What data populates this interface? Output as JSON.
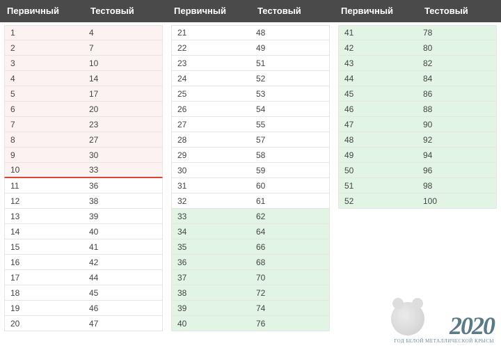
{
  "headers": {
    "primary": "Первичный",
    "test": "Тестовый"
  },
  "columns": [
    {
      "rows": [
        {
          "p": "1",
          "t": "4",
          "tone": "red"
        },
        {
          "p": "2",
          "t": "7",
          "tone": "red"
        },
        {
          "p": "3",
          "t": "10",
          "tone": "red"
        },
        {
          "p": "4",
          "t": "14",
          "tone": "red"
        },
        {
          "p": "5",
          "t": "17",
          "tone": "red"
        },
        {
          "p": "6",
          "t": "20",
          "tone": "red"
        },
        {
          "p": "7",
          "t": "23",
          "tone": "red"
        },
        {
          "p": "8",
          "t": "27",
          "tone": "red"
        },
        {
          "p": "9",
          "t": "30",
          "tone": "red"
        },
        {
          "p": "10",
          "t": "33",
          "tone": "red",
          "redline": true
        },
        {
          "p": "11",
          "t": "36",
          "tone": "white"
        },
        {
          "p": "12",
          "t": "38",
          "tone": "white"
        },
        {
          "p": "13",
          "t": "39",
          "tone": "white"
        },
        {
          "p": "14",
          "t": "40",
          "tone": "white"
        },
        {
          "p": "15",
          "t": "41",
          "tone": "white"
        },
        {
          "p": "16",
          "t": "42",
          "tone": "white"
        },
        {
          "p": "17",
          "t": "44",
          "tone": "white"
        },
        {
          "p": "18",
          "t": "45",
          "tone": "white"
        },
        {
          "p": "19",
          "t": "46",
          "tone": "white"
        },
        {
          "p": "20",
          "t": "47",
          "tone": "white"
        }
      ]
    },
    {
      "rows": [
        {
          "p": "21",
          "t": "48",
          "tone": "white"
        },
        {
          "p": "22",
          "t": "49",
          "tone": "white"
        },
        {
          "p": "23",
          "t": "51",
          "tone": "white"
        },
        {
          "p": "24",
          "t": "52",
          "tone": "white"
        },
        {
          "p": "25",
          "t": "53",
          "tone": "white"
        },
        {
          "p": "26",
          "t": "54",
          "tone": "white"
        },
        {
          "p": "27",
          "t": "55",
          "tone": "white"
        },
        {
          "p": "28",
          "t": "57",
          "tone": "white"
        },
        {
          "p": "29",
          "t": "58",
          "tone": "white"
        },
        {
          "p": "30",
          "t": "59",
          "tone": "white"
        },
        {
          "p": "31",
          "t": "60",
          "tone": "white"
        },
        {
          "p": "32",
          "t": "61",
          "tone": "white"
        },
        {
          "p": "33",
          "t": "62",
          "tone": "green"
        },
        {
          "p": "34",
          "t": "64",
          "tone": "green"
        },
        {
          "p": "35",
          "t": "66",
          "tone": "green"
        },
        {
          "p": "36",
          "t": "68",
          "tone": "green"
        },
        {
          "p": "37",
          "t": "70",
          "tone": "green"
        },
        {
          "p": "38",
          "t": "72",
          "tone": "green"
        },
        {
          "p": "39",
          "t": "74",
          "tone": "green"
        },
        {
          "p": "40",
          "t": "76",
          "tone": "green"
        }
      ]
    },
    {
      "rows": [
        {
          "p": "41",
          "t": "78",
          "tone": "green"
        },
        {
          "p": "42",
          "t": "80",
          "tone": "green"
        },
        {
          "p": "43",
          "t": "82",
          "tone": "green"
        },
        {
          "p": "44",
          "t": "84",
          "tone": "green"
        },
        {
          "p": "45",
          "t": "86",
          "tone": "green"
        },
        {
          "p": "46",
          "t": "88",
          "tone": "green"
        },
        {
          "p": "47",
          "t": "90",
          "tone": "green"
        },
        {
          "p": "48",
          "t": "92",
          "tone": "green"
        },
        {
          "p": "49",
          "t": "94",
          "tone": "green"
        },
        {
          "p": "50",
          "t": "96",
          "tone": "green"
        },
        {
          "p": "51",
          "t": "98",
          "tone": "green"
        },
        {
          "p": "52",
          "t": "100",
          "tone": "green"
        }
      ]
    }
  ],
  "watermark": {
    "year": "2020",
    "sub": "ГОД БЕЛОЙ МЕТАЛЛИЧЕСКОЙ КРЫСЫ"
  }
}
